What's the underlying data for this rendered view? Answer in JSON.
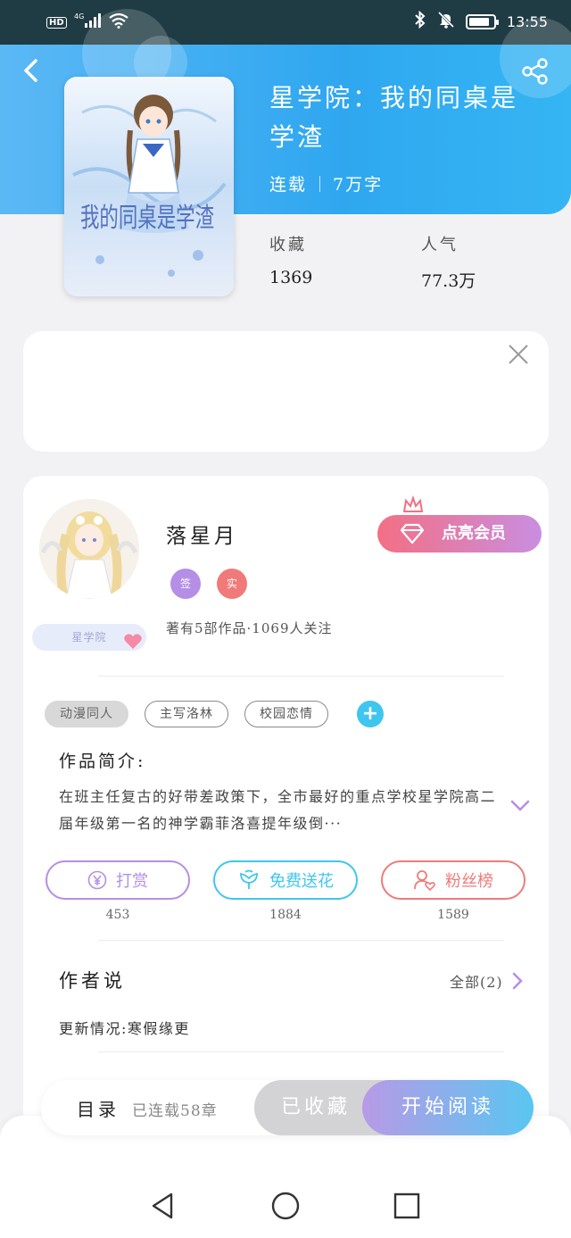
{
  "status_bar": {
    "network": "HD",
    "signal": "4G",
    "time": "13:55",
    "battery_level": 0.85
  },
  "book": {
    "title": "星学院：我的同桌是学渣",
    "status": "连载",
    "word_count": "7万字",
    "favorites_label": "收藏",
    "favorites_value": "1369",
    "popularity_label": "人气",
    "popularity_value": "77.3万",
    "cover_text": "我的同桌是学渣"
  },
  "author": {
    "name": "落星月",
    "badge_1": "签",
    "badge_2": "实",
    "avatar_tag": "星学院",
    "stats": "著有5部作品·1069人关注",
    "vip_button": "点亮会员"
  },
  "tags": [
    "动漫同人",
    "主写洛林",
    "校园恋情"
  ],
  "intro": {
    "label": "作品简介:",
    "text": "在班主任复古的好带差政策下，全市最好的重点学校星学院高二届年级第一名的神学霸菲洛喜提年级倒···"
  },
  "actions": {
    "reward_label": "打赏",
    "reward_count": "453",
    "flower_label": "免费送花",
    "flower_count": "1884",
    "fans_label": "粉丝榜",
    "fans_count": "1589"
  },
  "author_says": {
    "label": "作者说",
    "all": "全部(2)",
    "content": "更新情况:寒假缘更"
  },
  "bottom_bar": {
    "toc_label": "目录",
    "toc_status": "已连载58章",
    "favorited": "已收藏",
    "read": "开始阅读"
  },
  "colors": {
    "header_blue": "#2fa7f0",
    "reward": "#b58ee6",
    "flower": "#3fc6ee",
    "fans": "#f07a7a",
    "vip_start": "#f36f84",
    "vip_end": "#c98ee0"
  }
}
